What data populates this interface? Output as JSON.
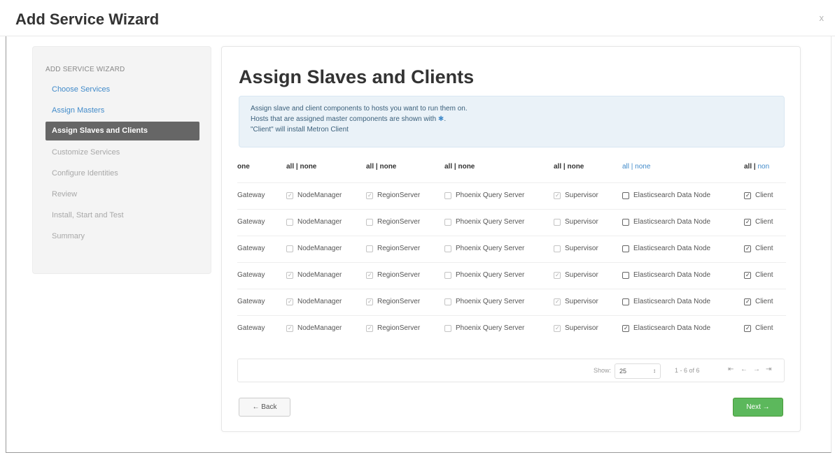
{
  "modal": {
    "title": "Add Service Wizard",
    "close_label": "x"
  },
  "sidebar": {
    "heading": "ADD SERVICE WIZARD",
    "items": [
      {
        "label": "Choose Services",
        "state": "done"
      },
      {
        "label": "Assign Masters",
        "state": "done"
      },
      {
        "label": "Assign Slaves and Clients",
        "state": "active"
      },
      {
        "label": "Customize Services",
        "state": "pending"
      },
      {
        "label": "Configure Identities",
        "state": "pending"
      },
      {
        "label": "Review",
        "state": "pending"
      },
      {
        "label": "Install, Start and Test",
        "state": "pending"
      },
      {
        "label": "Summary",
        "state": "pending"
      }
    ]
  },
  "main": {
    "title": "Assign Slaves and Clients",
    "alert": {
      "line1": "Assign slave and client components to hosts you want to run them on.",
      "line2_prefix": "Hosts that are assigned master components are shown with",
      "line2_marker": "✱",
      "line2_suffix": ".",
      "line3": "\"Client\" will install Metron Client"
    }
  },
  "grid": {
    "header": {
      "col0": "one",
      "all": "all",
      "sep": " | ",
      "none": "none",
      "last_none": "non"
    },
    "columns": [
      "Gateway",
      "NodeManager",
      "RegionServer",
      "Phoenix Query Server",
      "Supervisor",
      "Elasticsearch Data Node",
      "Client"
    ],
    "rows": [
      {
        "gateway": "Gateway",
        "nodemanager": true,
        "regionserver": true,
        "phoenix": false,
        "supervisor": true,
        "elasticsearch": false,
        "client": true
      },
      {
        "gateway": "Gateway",
        "nodemanager": false,
        "regionserver": false,
        "phoenix": false,
        "supervisor": false,
        "elasticsearch": false,
        "client": true
      },
      {
        "gateway": "Gateway",
        "nodemanager": false,
        "regionserver": false,
        "phoenix": false,
        "supervisor": false,
        "elasticsearch": false,
        "client": true
      },
      {
        "gateway": "Gateway",
        "nodemanager": true,
        "regionserver": true,
        "phoenix": false,
        "supervisor": true,
        "elasticsearch": false,
        "client": true
      },
      {
        "gateway": "Gateway",
        "nodemanager": true,
        "regionserver": true,
        "phoenix": false,
        "supervisor": true,
        "elasticsearch": false,
        "client": true
      },
      {
        "gateway": "Gateway",
        "nodemanager": true,
        "regionserver": true,
        "phoenix": false,
        "supervisor": true,
        "elasticsearch": true,
        "client": true
      }
    ]
  },
  "pager": {
    "show_label": "Show:",
    "page_size": "25",
    "select_arrow": "↕",
    "range": "1 - 6 of 6",
    "first": "⇤",
    "prev": "←",
    "next": "→",
    "last": "⇥"
  },
  "buttons": {
    "back": "← Back",
    "next": "Next →"
  },
  "colors": {
    "accent": "#428bca",
    "success": "#5cb85c",
    "active_nav": "#666666"
  }
}
